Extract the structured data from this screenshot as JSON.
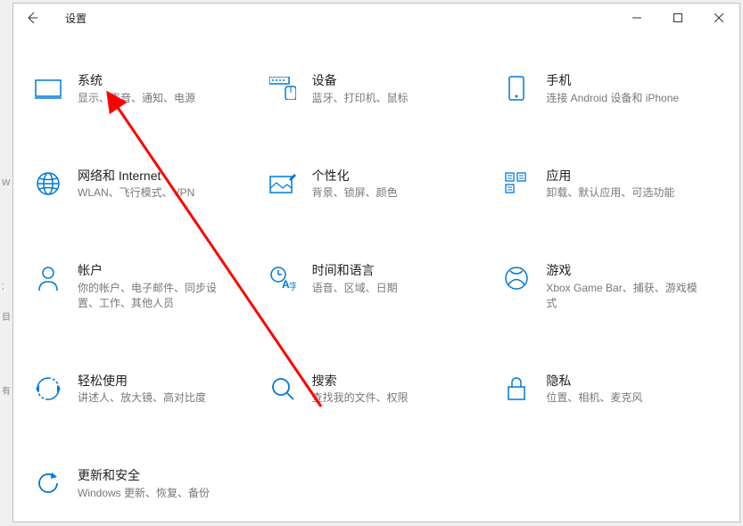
{
  "titlebar": {
    "title": "设置"
  },
  "settings": [
    {
      "key": "system",
      "title": "系统",
      "subtitle": "显示、声音、通知、电源"
    },
    {
      "key": "devices",
      "title": "设备",
      "subtitle": "蓝牙、打印机、鼠标"
    },
    {
      "key": "phone",
      "title": "手机",
      "subtitle": "连接 Android 设备和 iPhone"
    },
    {
      "key": "network",
      "title": "网络和 Internet",
      "subtitle": "WLAN、飞行模式、VPN"
    },
    {
      "key": "personalization",
      "title": "个性化",
      "subtitle": "背景、锁屏、颜色"
    },
    {
      "key": "apps",
      "title": "应用",
      "subtitle": "卸载、默认应用、可选功能"
    },
    {
      "key": "accounts",
      "title": "帐户",
      "subtitle": "你的帐户、电子邮件、同步设置、工作、其他人员"
    },
    {
      "key": "time",
      "title": "时间和语言",
      "subtitle": "语音、区域、日期"
    },
    {
      "key": "gaming",
      "title": "游戏",
      "subtitle": "Xbox Game Bar、捕获、游戏模式"
    },
    {
      "key": "ease",
      "title": "轻松使用",
      "subtitle": "讲述人、放大镜、高对比度"
    },
    {
      "key": "search",
      "title": "搜索",
      "subtitle": "查找我的文件、权限"
    },
    {
      "key": "privacy",
      "title": "隐私",
      "subtitle": "位置、相机、麦克风"
    },
    {
      "key": "update",
      "title": "更新和安全",
      "subtitle": "Windows 更新、恢复、备份"
    }
  ],
  "colors": {
    "accent": "#0078d7",
    "arrow": "#ff0000"
  }
}
